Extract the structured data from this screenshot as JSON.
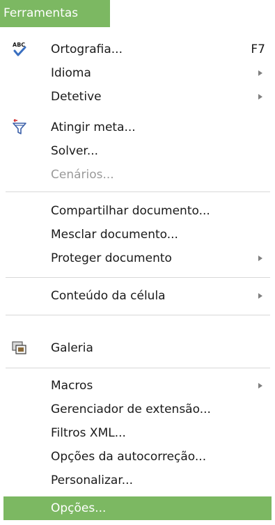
{
  "menu_title": "Ferramentas",
  "colors": {
    "accent": "#7cb862",
    "text": "#1a1a1a",
    "disabled": "#9a9a9a"
  },
  "items": [
    {
      "label": "Ortografia...",
      "shortcut": "F7",
      "icon": "spellcheck-icon"
    },
    {
      "label": "Idioma",
      "submenu": true
    },
    {
      "label": "Detetive",
      "submenu": true
    },
    {
      "label": "Atingir meta...",
      "icon": "goal-seek-funnel-icon"
    },
    {
      "label": "Solver..."
    },
    {
      "label": "Cenários...",
      "disabled": true
    },
    {
      "label": "Compartilhar documento..."
    },
    {
      "label": "Mesclar documento..."
    },
    {
      "label": "Proteger documento",
      "submenu": true
    },
    {
      "label": "Conteúdo da célula",
      "submenu": true
    },
    {
      "label": "Galeria",
      "icon": "gallery-icon"
    },
    {
      "label": "Macros",
      "submenu": true
    },
    {
      "label": "Gerenciador de extensão..."
    },
    {
      "label": "Filtros XML..."
    },
    {
      "label": "Opções da autocorreção..."
    },
    {
      "label": "Personalizar..."
    },
    {
      "label": "Opções...",
      "highlighted": true
    }
  ]
}
